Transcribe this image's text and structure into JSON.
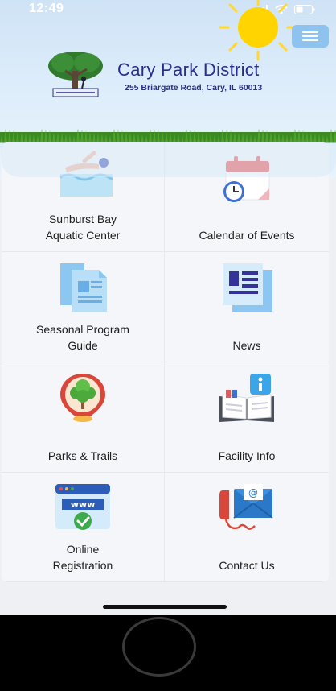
{
  "status_bar": {
    "time": "12:49"
  },
  "header": {
    "district_name": "Cary Park District",
    "address": "255 Briargate Road, Cary, IL  60013"
  },
  "tiles": [
    {
      "line1": "Sunburst Bay",
      "line2": "Aquatic Center",
      "icon": "swimmer-icon"
    },
    {
      "line1": "",
      "line2": "Calendar of Events",
      "icon": "calendar-icon"
    },
    {
      "line1": "Seasonal Program",
      "line2": "Guide",
      "icon": "documents-icon"
    },
    {
      "line1": "",
      "line2": "News",
      "icon": "newspaper-icon"
    },
    {
      "line1": "",
      "line2": "Parks & Trails",
      "icon": "park-pin-icon"
    },
    {
      "line1": "",
      "line2": "Facility Info",
      "icon": "info-book-icon"
    },
    {
      "line1": "Online",
      "line2": "Registration",
      "icon": "www-check-icon"
    },
    {
      "line1": "",
      "line2": "Contact Us",
      "icon": "phone-mail-icon"
    }
  ],
  "colors": {
    "brand": "#2a2d8c",
    "menu_button": "#8ec2ef",
    "header_bg": "#cfe3f6"
  }
}
